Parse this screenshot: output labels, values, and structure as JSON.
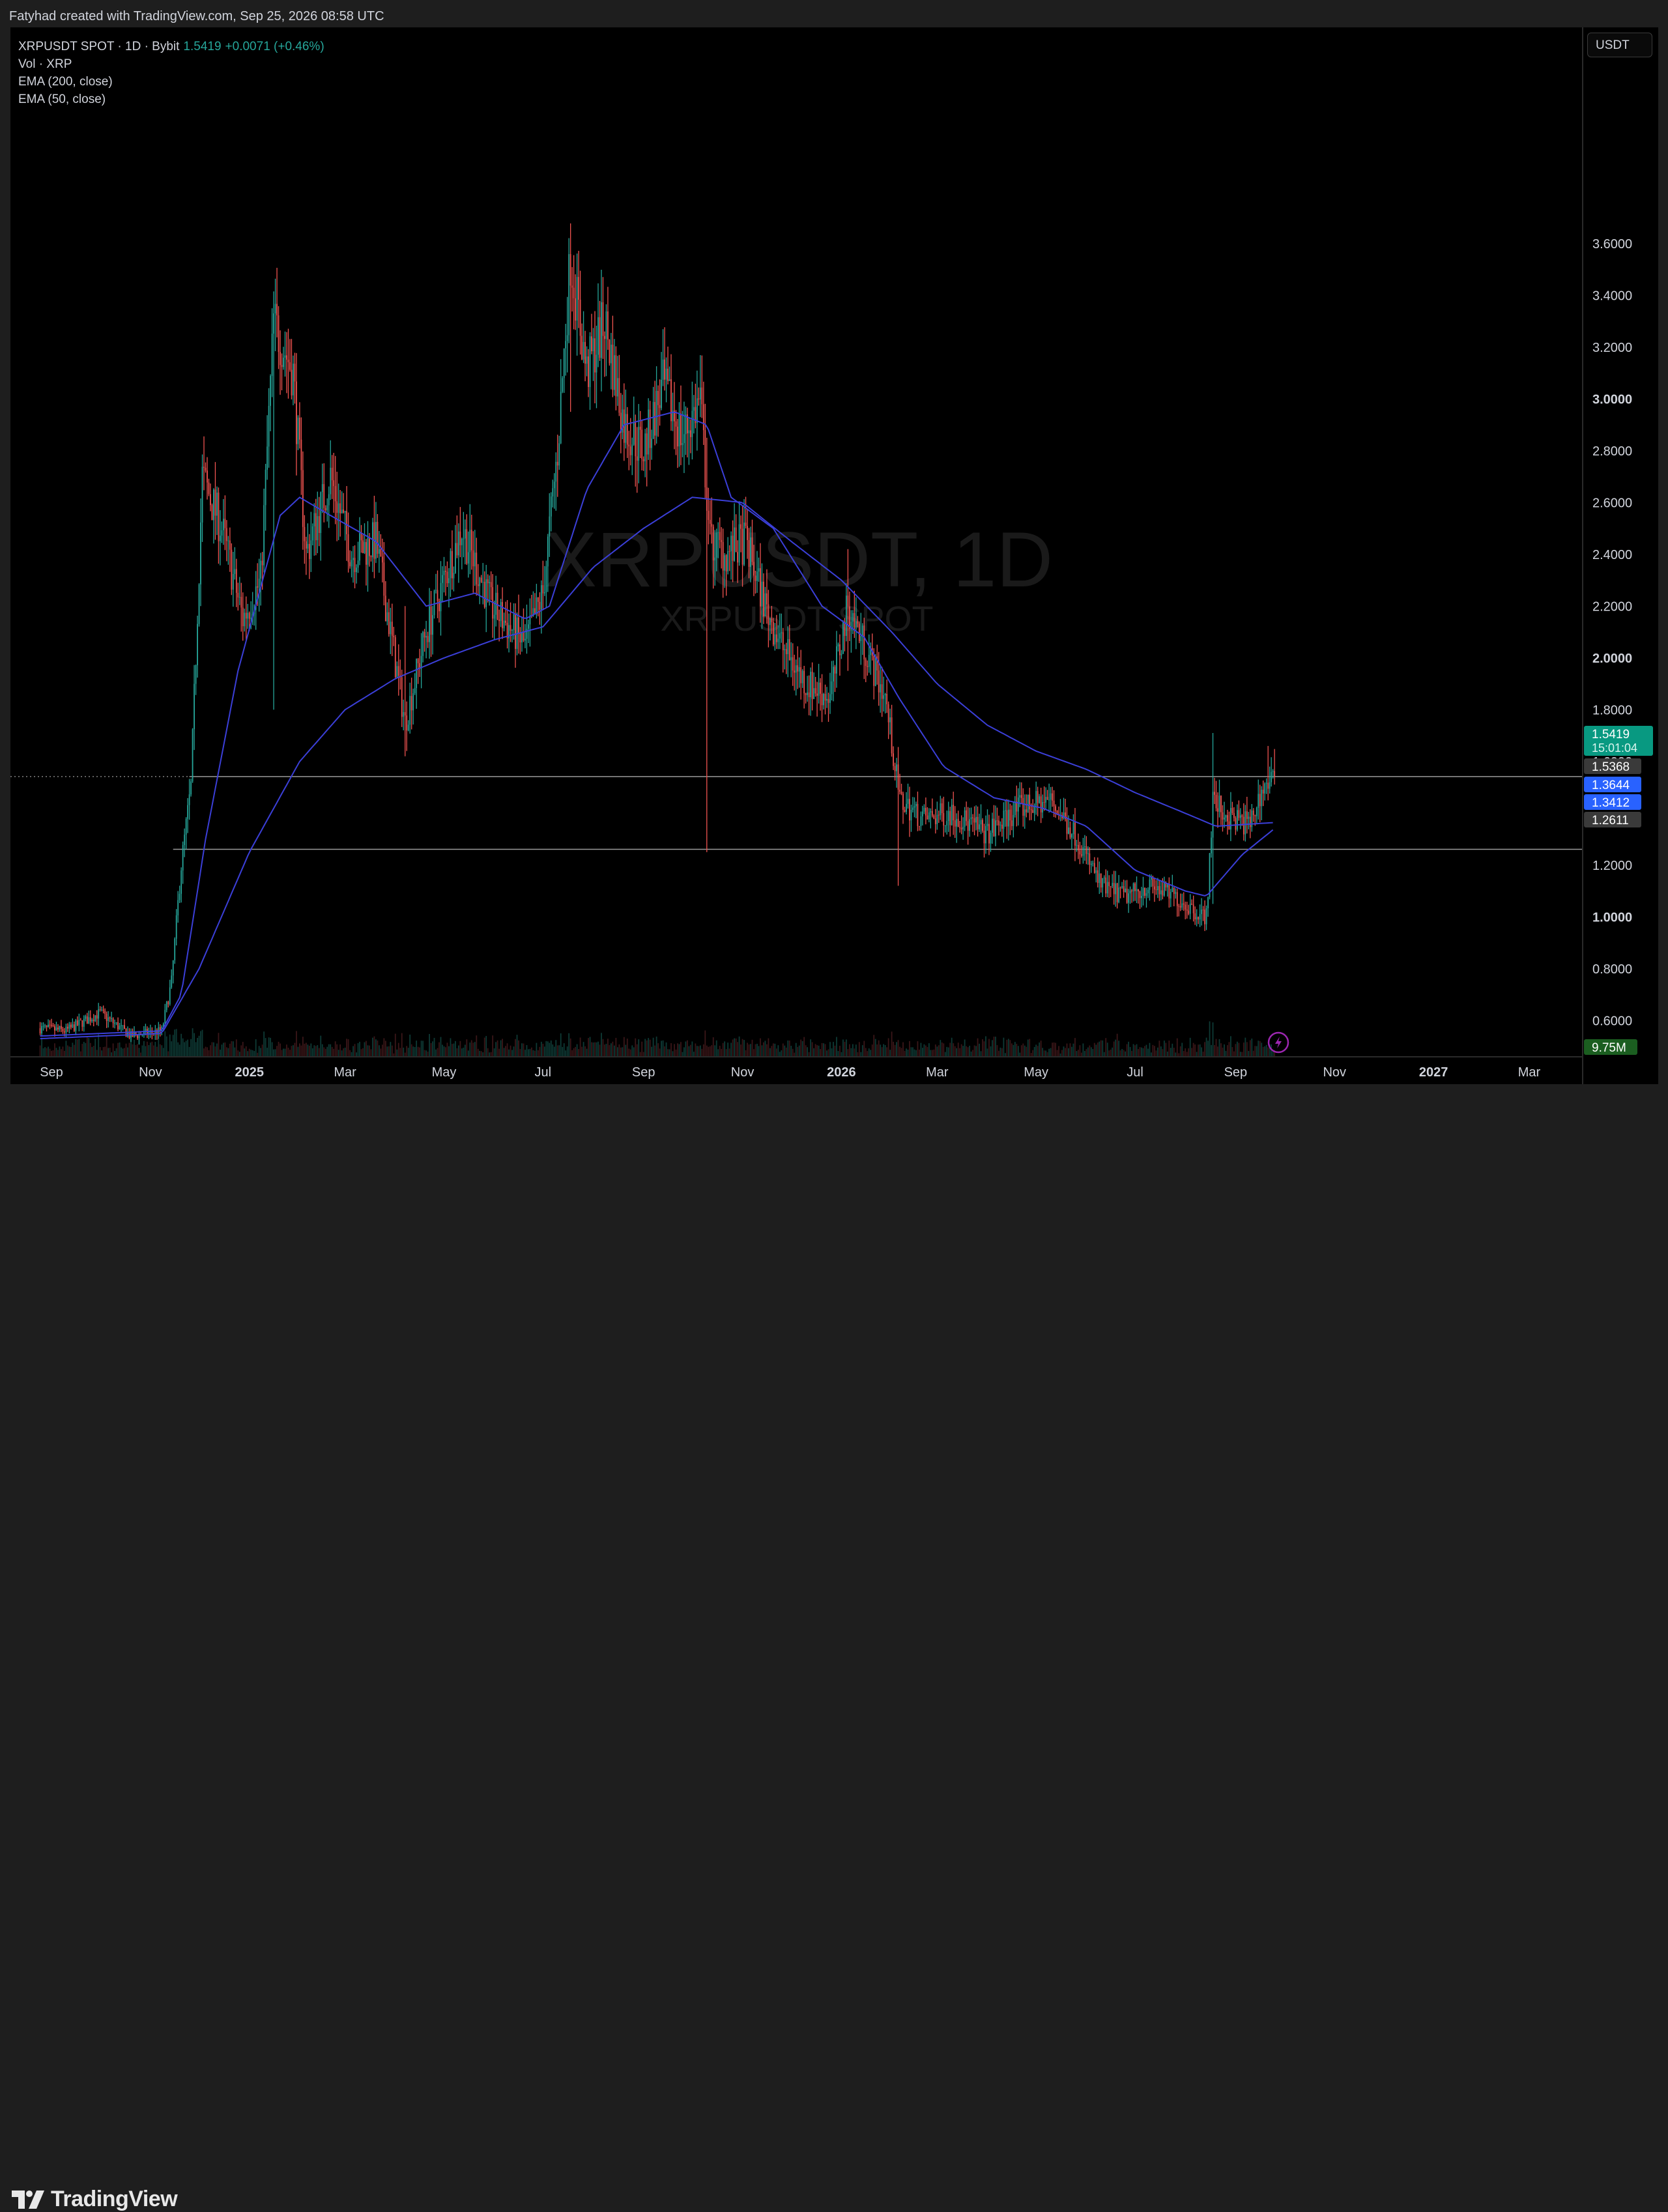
{
  "header": {
    "credit": "Fatyhad created with TradingView.com, Sep 25, 2026 08:58 UTC"
  },
  "legend": {
    "symbol_line": "XRPUSDT SPOT · 1D · Bybit",
    "last_price": "1.5419",
    "change": "+0.0071 (+0.46%)",
    "volume_label": "Vol · XRP",
    "ema200_label": "EMA (200, close)",
    "ema50_label": "EMA (50, close)"
  },
  "currency_button": "USDT",
  "watermark": {
    "main": "XRPUSDT, 1D",
    "sub": "XRPUSDT SPOT"
  },
  "brand": {
    "name": "TradingView"
  },
  "colors": {
    "up": "#26a69a",
    "down": "#ef5350",
    "ema": "#3b3fd8",
    "last_badge": "#089981",
    "ema_badge": "#2962ff",
    "level_badge": "#3a3a3a"
  },
  "icons": {
    "brand": "tradingview-logo-icon",
    "lightning": "lightning-icon"
  },
  "chart_data": {
    "type": "candlestick",
    "symbol": "XRPUSDT",
    "timeframe": "1D",
    "y_scale": {
      "min": 0.5,
      "max": 3.7,
      "ticks": [
        "3.6000",
        "3.4000",
        "3.2000",
        "3.0000",
        "2.8000",
        "2.6000",
        "2.4000",
        "2.2000",
        "2.0000",
        "1.8000",
        "1.6000",
        "1.2000",
        "1.0000",
        "0.8000",
        "0.6000"
      ],
      "bold_ticks": [
        "3.0000",
        "2.0000",
        "1.0000"
      ]
    },
    "x_axis": {
      "labels": [
        {
          "date": "2024-09-01",
          "text": "Sep",
          "bold": false
        },
        {
          "date": "2024-11-01",
          "text": "Nov",
          "bold": false
        },
        {
          "date": "2025-01-01",
          "text": "2025",
          "bold": true
        },
        {
          "date": "2025-03-01",
          "text": "Mar",
          "bold": false
        },
        {
          "date": "2025-05-01",
          "text": "May",
          "bold": false
        },
        {
          "date": "2025-07-01",
          "text": "Jul",
          "bold": false
        },
        {
          "date": "2025-09-01",
          "text": "Sep",
          "bold": false
        },
        {
          "date": "2025-11-01",
          "text": "Nov",
          "bold": false
        },
        {
          "date": "2026-01-01",
          "text": "2026",
          "bold": true
        },
        {
          "date": "2026-03-01",
          "text": "Mar",
          "bold": false
        },
        {
          "date": "2026-05-01",
          "text": "May",
          "bold": false
        },
        {
          "date": "2026-07-01",
          "text": "Jul",
          "bold": false
        },
        {
          "date": "2026-09-01",
          "text": "Sep",
          "bold": false
        },
        {
          "date": "2026-11-01",
          "text": "Nov",
          "bold": false
        },
        {
          "date": "2027-01-01",
          "text": "2027",
          "bold": true
        },
        {
          "date": "2027-03-01",
          "text": "Mar",
          "bold": false
        }
      ]
    },
    "price_path": [
      {
        "date": "2024-08-25",
        "price": 0.57
      },
      {
        "date": "2024-09-10",
        "price": 0.56
      },
      {
        "date": "2024-10-01",
        "price": 0.63
      },
      {
        "date": "2024-10-20",
        "price": 0.54
      },
      {
        "date": "2024-11-08",
        "price": 0.56
      },
      {
        "date": "2024-11-14",
        "price": 0.75
      },
      {
        "date": "2024-11-20",
        "price": 1.2
      },
      {
        "date": "2024-11-26",
        "price": 1.5
      },
      {
        "date": "2024-12-03",
        "price": 2.7
      },
      {
        "date": "2024-12-15",
        "price": 2.5
      },
      {
        "date": "2024-12-28",
        "price": 2.15
      },
      {
        "date": "2025-01-08",
        "price": 2.3
      },
      {
        "date": "2025-01-16",
        "price": 3.3
      },
      {
        "date": "2025-01-28",
        "price": 3.1
      },
      {
        "date": "2025-02-05",
        "price": 2.4
      },
      {
        "date": "2025-02-20",
        "price": 2.7
      },
      {
        "date": "2025-03-05",
        "price": 2.4
      },
      {
        "date": "2025-03-20",
        "price": 2.45
      },
      {
        "date": "2025-04-07",
        "price": 1.75
      },
      {
        "date": "2025-04-20",
        "price": 2.1
      },
      {
        "date": "2025-05-12",
        "price": 2.5
      },
      {
        "date": "2025-05-30",
        "price": 2.2
      },
      {
        "date": "2025-06-20",
        "price": 2.05
      },
      {
        "date": "2025-07-01",
        "price": 2.25
      },
      {
        "date": "2025-07-10",
        "price": 2.8
      },
      {
        "date": "2025-07-18",
        "price": 3.55
      },
      {
        "date": "2025-07-28",
        "price": 3.1
      },
      {
        "date": "2025-08-08",
        "price": 3.3
      },
      {
        "date": "2025-08-20",
        "price": 2.9
      },
      {
        "date": "2025-09-01",
        "price": 2.8
      },
      {
        "date": "2025-09-13",
        "price": 3.05
      },
      {
        "date": "2025-09-25",
        "price": 2.85
      },
      {
        "date": "2025-10-06",
        "price": 3.0
      },
      {
        "date": "2025-10-12",
        "price": 2.45
      },
      {
        "date": "2025-10-22",
        "price": 2.4
      },
      {
        "date": "2025-11-03",
        "price": 2.45
      },
      {
        "date": "2025-11-15",
        "price": 2.2
      },
      {
        "date": "2025-11-25",
        "price": 2.05
      },
      {
        "date": "2025-12-10",
        "price": 1.9
      },
      {
        "date": "2025-12-25",
        "price": 1.85
      },
      {
        "date": "2026-01-05",
        "price": 2.2
      },
      {
        "date": "2026-01-15",
        "price": 2.05
      },
      {
        "date": "2026-01-28",
        "price": 1.85
      },
      {
        "date": "2026-02-06",
        "price": 1.45
      },
      {
        "date": "2026-02-20",
        "price": 1.38
      },
      {
        "date": "2026-03-10",
        "price": 1.4
      },
      {
        "date": "2026-04-01",
        "price": 1.32
      },
      {
        "date": "2026-04-20",
        "price": 1.42
      },
      {
        "date": "2026-05-10",
        "price": 1.45
      },
      {
        "date": "2026-05-25",
        "price": 1.32
      },
      {
        "date": "2026-06-10",
        "price": 1.12
      },
      {
        "date": "2026-06-25",
        "price": 1.08
      },
      {
        "date": "2026-07-10",
        "price": 1.12
      },
      {
        "date": "2026-07-25",
        "price": 1.08
      },
      {
        "date": "2026-08-08",
        "price": 1.02
      },
      {
        "date": "2026-08-14",
        "price": 1.0
      },
      {
        "date": "2026-08-18",
        "price": 1.45
      },
      {
        "date": "2026-08-28",
        "price": 1.38
      },
      {
        "date": "2026-09-10",
        "price": 1.36
      },
      {
        "date": "2026-09-18",
        "price": 1.5
      },
      {
        "date": "2026-09-25",
        "price": 1.5419
      }
    ],
    "spikes": [
      {
        "date": "2025-01-16",
        "high": 3.4,
        "low": 1.8
      },
      {
        "date": "2025-04-07",
        "high": 2.2,
        "low": 1.62
      },
      {
        "date": "2025-07-18",
        "high": 3.66,
        "low": 2.95
      },
      {
        "date": "2025-10-10",
        "high": 2.85,
        "low": 1.25
      },
      {
        "date": "2026-01-05",
        "high": 2.42,
        "low": 1.95
      },
      {
        "date": "2026-02-05",
        "high": 1.6,
        "low": 1.12
      },
      {
        "date": "2026-08-18",
        "high": 1.71,
        "low": 1.05
      },
      {
        "date": "2026-09-21",
        "high": 1.66,
        "low": 1.45
      }
    ],
    "ema50": [
      {
        "date": "2024-08-25",
        "value": 0.54
      },
      {
        "date": "2024-11-08",
        "value": 0.56
      },
      {
        "date": "2024-11-20",
        "value": 0.7
      },
      {
        "date": "2024-12-05",
        "value": 1.3
      },
      {
        "date": "2024-12-25",
        "value": 1.95
      },
      {
        "date": "2025-01-20",
        "value": 2.55
      },
      {
        "date": "2025-02-01",
        "value": 2.62
      },
      {
        "date": "2025-02-20",
        "value": 2.55
      },
      {
        "date": "2025-03-20",
        "value": 2.45
      },
      {
        "date": "2025-04-20",
        "value": 2.2
      },
      {
        "date": "2025-05-20",
        "value": 2.25
      },
      {
        "date": "2025-06-20",
        "value": 2.15
      },
      {
        "date": "2025-07-05",
        "value": 2.2
      },
      {
        "date": "2025-07-28",
        "value": 2.65
      },
      {
        "date": "2025-08-20",
        "value": 2.9
      },
      {
        "date": "2025-09-20",
        "value": 2.95
      },
      {
        "date": "2025-10-10",
        "value": 2.9
      },
      {
        "date": "2025-10-25",
        "value": 2.62
      },
      {
        "date": "2025-11-20",
        "value": 2.5
      },
      {
        "date": "2025-12-20",
        "value": 2.2
      },
      {
        "date": "2026-01-15",
        "value": 2.08
      },
      {
        "date": "2026-02-05",
        "value": 1.85
      },
      {
        "date": "2026-03-05",
        "value": 1.58
      },
      {
        "date": "2026-04-05",
        "value": 1.46
      },
      {
        "date": "2026-05-05",
        "value": 1.42
      },
      {
        "date": "2026-06-01",
        "value": 1.35
      },
      {
        "date": "2026-07-01",
        "value": 1.18
      },
      {
        "date": "2026-08-01",
        "value": 1.1
      },
      {
        "date": "2026-08-14",
        "value": 1.08
      },
      {
        "date": "2026-09-05",
        "value": 1.24
      },
      {
        "date": "2026-09-25",
        "value": 1.3412
      }
    ],
    "ema200": [
      {
        "date": "2024-08-25",
        "value": 0.53
      },
      {
        "date": "2024-11-08",
        "value": 0.55
      },
      {
        "date": "2024-12-01",
        "value": 0.8
      },
      {
        "date": "2025-01-01",
        "value": 1.25
      },
      {
        "date": "2025-02-01",
        "value": 1.6
      },
      {
        "date": "2025-03-01",
        "value": 1.8
      },
      {
        "date": "2025-04-01",
        "value": 1.92
      },
      {
        "date": "2025-05-01",
        "value": 2.0
      },
      {
        "date": "2025-06-01",
        "value": 2.07
      },
      {
        "date": "2025-07-01",
        "value": 2.12
      },
      {
        "date": "2025-08-01",
        "value": 2.35
      },
      {
        "date": "2025-09-01",
        "value": 2.5
      },
      {
        "date": "2025-10-01",
        "value": 2.62
      },
      {
        "date": "2025-11-01",
        "value": 2.6
      },
      {
        "date": "2025-12-01",
        "value": 2.45
      },
      {
        "date": "2026-01-01",
        "value": 2.3
      },
      {
        "date": "2026-02-01",
        "value": 2.1
      },
      {
        "date": "2026-03-01",
        "value": 1.9
      },
      {
        "date": "2026-04-01",
        "value": 1.74
      },
      {
        "date": "2026-05-01",
        "value": 1.64
      },
      {
        "date": "2026-06-01",
        "value": 1.57
      },
      {
        "date": "2026-07-01",
        "value": 1.48
      },
      {
        "date": "2026-08-01",
        "value": 1.4
      },
      {
        "date": "2026-08-20",
        "value": 1.35
      },
      {
        "date": "2026-09-25",
        "value": 1.3644
      }
    ],
    "horizontal_levels": [
      {
        "value": 1.5419,
        "start_date": "2024-08-25",
        "style": "dotted-then-solid",
        "solid_from": "2024-11-25"
      },
      {
        "value": 1.2611,
        "start_date": "2024-11-15",
        "style": "solid"
      }
    ],
    "price_badges": [
      {
        "text": "1.5419",
        "sub": "15:01:04",
        "kind": "last",
        "value": 1.5419
      },
      {
        "text": "1.5368",
        "kind": "level",
        "value": 1.5368
      },
      {
        "text": "1.3644",
        "kind": "ema",
        "value": 1.3644
      },
      {
        "text": "1.3412",
        "kind": "ema",
        "value": 1.3412
      },
      {
        "text": "1.2611",
        "kind": "level",
        "value": 1.2611
      }
    ],
    "volume_badge": "9.75M"
  }
}
